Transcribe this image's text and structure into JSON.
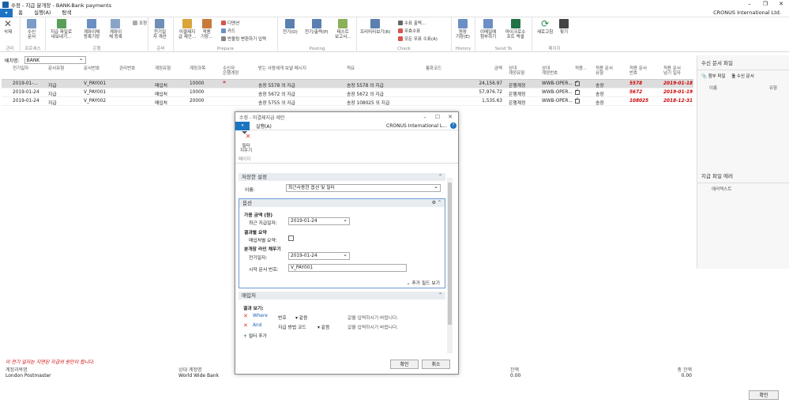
{
  "window": {
    "title": "수정 - 지급 분개장 - BANK-Bank payments",
    "company": "CRONUS International Ltd."
  },
  "menu": {
    "file": "▾",
    "items": [
      "홈",
      "실행(A)",
      "탐색"
    ]
  },
  "ribbon": {
    "groups": [
      "관리",
      "프로세스",
      "은행",
      "준비",
      "Prepare",
      "Posting",
      "Check",
      "History",
      "Send To",
      "페이지"
    ],
    "buttons": {
      "delete": "삭제",
      "incoming_doc": "수신\n문서",
      "export_pay": "지급 파일로\n내보내기...",
      "reconcile": "계좌이체\n등록기장",
      "bank_reg": "계좌이\n체 등록",
      "adjust": "조정",
      "calc_posting": "전기일\n자 계산",
      "suggest": "미결제지\n급 제안...",
      "apply": "적용\n기장...",
      "dimension": "디멘션",
      "card": "카드",
      "insert_conv": "반올림 변환하기 입력",
      "post": "전기(O)",
      "post_print": "전기/출력(P)",
      "test_report": "테스트\n보고서...",
      "preview": "프리미리보기(R)",
      "print_check": "수표 출력...",
      "void_check": "무효수표",
      "void_all": "모든 무표 수표(A)",
      "ledger": "원장\n기장(E)",
      "email": "이메일에\n첨부하기",
      "excel": "마이크로소\n프트 엑셀",
      "refresh": "새로고침",
      "find": "찾기"
    }
  },
  "batch": {
    "label": "배치명:",
    "value": "BANK"
  },
  "grid": {
    "headers": [
      "전기일자",
      "문서유형",
      "문서번호",
      "관리번호",
      "계정유형",
      "계정과목",
      "수신자\n은행계정",
      "받는 사람에게 보낼 메시지",
      "적요",
      "통화코드",
      "금액",
      "상대\n계정유형",
      "상대\n계정번호",
      "적용...",
      "적용 문서\n유형",
      "적용 문서\n번호",
      "적용 문서\n넘기 일자"
    ],
    "rows": [
      [
        "2019-01-...",
        "지급",
        "V_PAY001",
        "",
        "매입처",
        "10000",
        "*",
        "송장 5578 의 지급",
        "송장 5578 의 지급",
        "",
        "24,156.97",
        "은행계정",
        "WWB-OPER...",
        "✓",
        "송장",
        "5578",
        "2019-01-18"
      ],
      [
        "2019-01-24",
        "지급",
        "V_PAY001",
        "",
        "매입처",
        "10000",
        "",
        "송장 5672 의 지급",
        "송장 5672 의 지급",
        "",
        "57,976.72",
        "은행계정",
        "WWB-OPER...",
        "✓",
        "송장",
        "5672",
        "2019-01-19"
      ],
      [
        "2019-01-24",
        "지급",
        "V_PAY002",
        "",
        "매입처",
        "20000",
        "",
        "송장 5755 의 지급",
        "송장 108025 의 지급",
        "",
        "1,535.63",
        "은행계정",
        "WWB-OPER...",
        "✓",
        "송장",
        "108025",
        "2018-12-31"
      ]
    ]
  },
  "right_pane": {
    "title": "수신 문서 파일",
    "attach": "첨부 파일",
    "incoming": "수신 문서",
    "col_name": "이름",
    "col_type": "유형",
    "errors_title": "지급 파일 에러",
    "errors_col": "에러텍스트"
  },
  "footer": {
    "message": "이 전기 일자는 지연된 지급의 원인이 됩니다.",
    "acct_name_label": "계정과목명",
    "acct_name": "London Postmaster",
    "bal_name_label": "상대 계정명",
    "bal_name": "World Wide Bank",
    "balance_label": "잔액",
    "balance": "0.00",
    "total_label": "총 잔액",
    "total": "0.00",
    "ok": "확인"
  },
  "dialog": {
    "title": "수정 - 미결제지급 제안",
    "menu_file": "▾",
    "menu_item": "실행(A)",
    "company": "CRONUS International L...",
    "filter_btn": "필터\n지우기",
    "page_label": "페이지",
    "saved": {
      "header": "저장한 설정",
      "name_label": "이름:",
      "name_value": "최근사용한 옵션 및 필터"
    },
    "options": {
      "header": "옵션",
      "avail": "가용 금액 (원)",
      "last_pay_label": "최근 지급일자:",
      "last_pay": "2019-01-24",
      "summarize": "결과별 요약",
      "summ_label": "매입처별 요약:",
      "fill": "분개장 라인 채우기",
      "posting_label": "전기일자:",
      "posting": "2019-01-24",
      "start_doc_label": "시작 문서 번호:",
      "start_doc": "V_PAY001",
      "more": "추가 필드 보기"
    },
    "vendor": {
      "header": "매입처",
      "show": "결과 보기:",
      "where": "Where",
      "and": "And",
      "f1": "번호",
      "f2": "지급 방법 코드",
      "eq": "같음",
      "ph": "값을 입력하시기 바랍니다.",
      "add": "필터 추가"
    },
    "ok": "확인",
    "cancel": "취소"
  }
}
